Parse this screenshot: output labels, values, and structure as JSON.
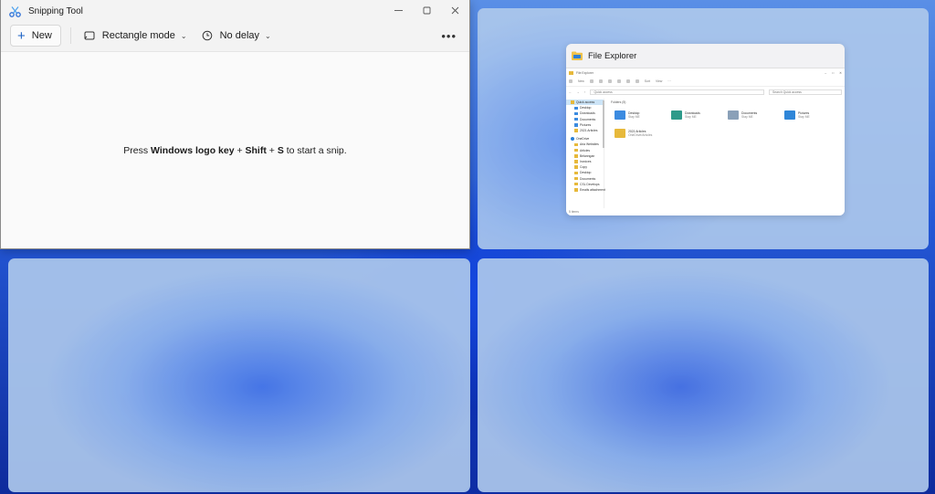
{
  "snipping_tool": {
    "title": "Snipping Tool",
    "new_label": "New",
    "mode_label": "Rectangle mode",
    "delay_label": "No delay",
    "more_label": "•••",
    "hint_prefix": "Press ",
    "hint_key1": "Windows logo key",
    "hint_plus1": " + ",
    "hint_key2": "Shift",
    "hint_plus2": " + ",
    "hint_key3": "S",
    "hint_suffix": " to start a snip."
  },
  "file_explorer_thumb": {
    "card_title": "File Explorer",
    "window_title": "File Explorer",
    "new_label": "New",
    "sort_label": "Sort",
    "view_label": "View",
    "address": "Quick access",
    "search_placeholder": "Search Quick access",
    "group_label": "Folders (5)",
    "status": "5 items",
    "nav": [
      {
        "label": "Quick access",
        "type": "qa",
        "selected": true
      },
      {
        "label": "Desktop",
        "type": "blue"
      },
      {
        "label": "Downloads",
        "type": "blue"
      },
      {
        "label": "Documents",
        "type": "blue"
      },
      {
        "label": "Pictures",
        "type": "blue"
      },
      {
        "label": "2021 Articles",
        "type": "folder"
      },
      {
        "label": "OneDrive",
        "type": "od"
      },
      {
        "label": "Aria Websites",
        "type": "folder"
      },
      {
        "label": "Articles",
        "type": "folder"
      },
      {
        "label": "Belanngan",
        "type": "folder"
      },
      {
        "label": "Invoices",
        "type": "folder"
      },
      {
        "label": "Copy",
        "type": "folder"
      },
      {
        "label": "Desktop",
        "type": "folder"
      },
      {
        "label": "Documents",
        "type": "folder"
      },
      {
        "label": "CSL Develops",
        "type": "folder"
      },
      {
        "label": "Emails attachment",
        "type": "folder"
      }
    ],
    "tiles": [
      {
        "name": "Desktop",
        "sub": "Stay ME",
        "color": "#3c8be0"
      },
      {
        "name": "Downloads",
        "sub": "Stay ME",
        "color": "#2e9a8a"
      },
      {
        "name": "Documents",
        "sub": "Stay ME",
        "color": "#8aa0b8"
      },
      {
        "name": "Pictures",
        "sub": "Stay ME",
        "color": "#2f86d8"
      },
      {
        "name": "2021 Articles",
        "sub": "OneDrive/Articles",
        "color": "#e7b93b"
      }
    ]
  }
}
